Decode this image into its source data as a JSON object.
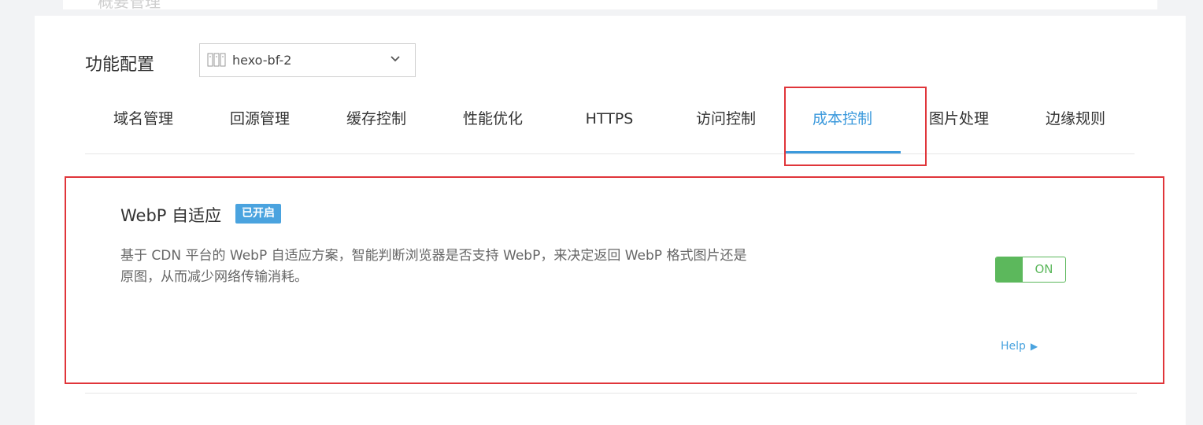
{
  "page": {
    "title": "功能配置",
    "top_ghost_text": "概要管理"
  },
  "domain_selector": {
    "value": "hexo-bf-2",
    "icon": "server-icon"
  },
  "tabs": [
    {
      "label": "域名管理",
      "active": false
    },
    {
      "label": "回源管理",
      "active": false
    },
    {
      "label": "缓存控制",
      "active": false
    },
    {
      "label": "性能优化",
      "active": false
    },
    {
      "label": "HTTPS",
      "active": false
    },
    {
      "label": "访问控制",
      "active": false
    },
    {
      "label": "成本控制",
      "active": true
    },
    {
      "label": "图片处理",
      "active": false
    },
    {
      "label": "边缘规则",
      "active": false
    }
  ],
  "feature": {
    "title": "WebP 自适应",
    "status_badge": "已开启",
    "description_line1": "基于 CDN 平台的 WebP 自适应方案，智能判断浏览器是否支持 WebP，来决定返回 WebP 格式图片还是",
    "description_line2": "原图，从而减少网络传输消耗。",
    "toggle_label": "ON",
    "toggle_on": true,
    "help_label": "Help",
    "help_arrow": "▶"
  },
  "colors": {
    "accent": "#3b99dc",
    "badge": "#4aa3df",
    "toggle_on": "#5cb85c",
    "highlight_box": "#e0353a"
  }
}
